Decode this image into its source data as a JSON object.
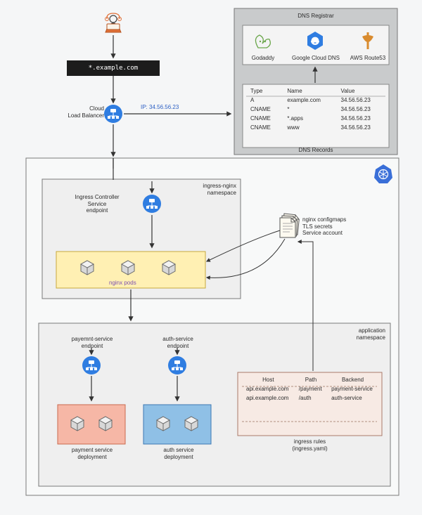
{
  "domain_bar": "*.example.com",
  "cloud_lb_label": "Cloud\nLoad Balancer",
  "ip_label": "IP: 34.56.56.23",
  "dns_registrar_title": "DNS Registrar",
  "dns_providers": {
    "godaddy": "Godaddy",
    "gcdns": "Google Cloud DNS",
    "route53": "AWS Route53"
  },
  "dns_records_title": "DNS Records",
  "dns_table": {
    "headers": [
      "Type",
      "Name",
      "Value"
    ],
    "rows": [
      [
        "A",
        "example.com",
        "34.56.56.23"
      ],
      [
        "CNAME",
        "*",
        "34.56.56.23"
      ],
      [
        "CNAME",
        "*.apps",
        "34.56.56.23"
      ],
      [
        "CNAME",
        "www",
        "34.56.56.23"
      ]
    ]
  },
  "ingress_namespace_label": "ingress-nginx\nnamespace",
  "ingress_svc_label": "Ingress Controller\nService\nendpoint",
  "nginx_pods_label": "nginx pods",
  "config_label": "nginx configmaps\nTLS secrets\nService account",
  "app_namespace_label": "application\nnamespace",
  "payment_endpoint_label": "payemnt-service\nendpoint",
  "auth_endpoint_label": "auth-service\nendpoint",
  "payment_deploy_label": "payment service\ndeployment",
  "auth_deploy_label": "auth service\ndeployment",
  "ingress_rules_title": "ingress rules\n(ingress.yaml)",
  "ingress_rules_table": {
    "headers": [
      "Host",
      "Path",
      "Backend"
    ],
    "rows": [
      [
        "api.example.com",
        "/payment",
        "payment-service"
      ],
      [
        "api.example.com",
        "/auth",
        "auth-service"
      ]
    ]
  }
}
